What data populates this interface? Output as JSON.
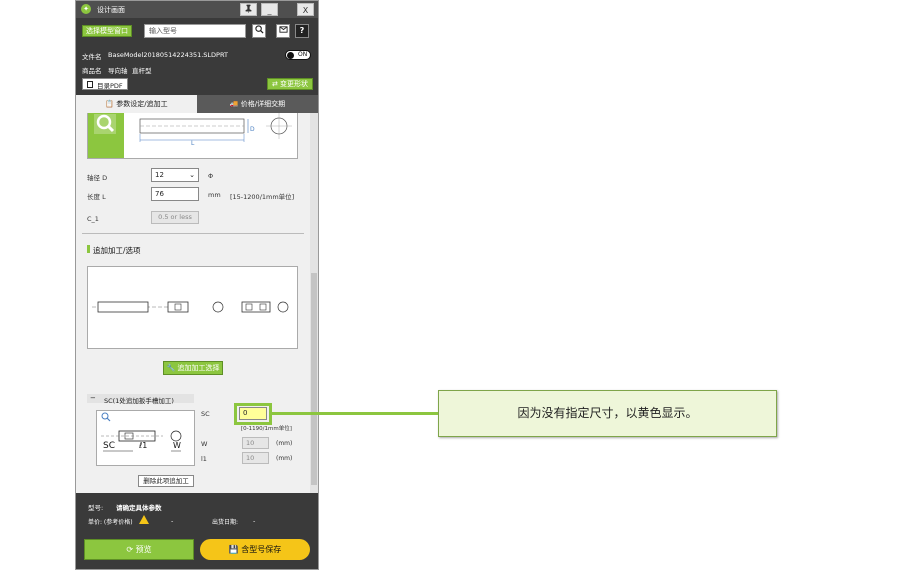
{
  "window": {
    "title": "设计画面",
    "pin_icon": "pin-icon",
    "minimize_label": "_",
    "close_label": "X"
  },
  "topbar": {
    "select_model_label": "选择模型窗口",
    "search_placeholder": "输入型号"
  },
  "info": {
    "file_label": "文件名",
    "file_value": "BaseModel20180514224351.SLDPRT",
    "product_label": "商品名",
    "product_value1": "导向轴",
    "product_value2": "直杆型",
    "toggle_text": "ON",
    "catalog_pdf_label": "目录PDF",
    "change_shape_label": "变更形状"
  },
  "tabs": {
    "params_label": "参数设定/追加工",
    "price_label": "价格/详细交期"
  },
  "params": {
    "shaft_d_label": "轴径 D",
    "shaft_d_value": "12",
    "shaft_d_unit": "Φ",
    "length_label": "长度 L",
    "length_value": "76",
    "length_unit": "mm",
    "length_range": "[15-1200/1mm单位]",
    "c1_label": "C_1",
    "c1_value": "0.5 or less",
    "diagram_d_label": "D",
    "diagram_l_label": "L"
  },
  "extra": {
    "section_title": "追加加工/选项",
    "add_processing_label": "追加加工选择",
    "sc_header": "SC(1处追加扳手槽加工)",
    "sc_label": "SC",
    "sc_value": "0",
    "sc_hint": "[0-1190/1mm单位]",
    "w_label": "W",
    "w_value": "10",
    "w_unit": "(mm)",
    "l1_label": "l1",
    "l1_value": "10",
    "l1_unit": "(mm)",
    "delete_label": "删除此项追加工",
    "fig_sc": "SC",
    "fig_l1": "ℓ1",
    "fig_w": "W"
  },
  "bottom": {
    "model_label": "型号:",
    "model_value": "请确定具体参数",
    "price_label": "单价: (参考价格)",
    "price_value": "-",
    "ship_label": "出货日期:",
    "ship_value": "-",
    "preview_label": "预览",
    "save_label": "含型号保存"
  },
  "callout": {
    "text": "因为没有指定尺寸，以黄色显示。"
  },
  "colors": {
    "accent": "#8cc63f",
    "highlight": "#ffff99",
    "save_button": "#f5c518",
    "dark_bar": "#3a3a3a"
  }
}
